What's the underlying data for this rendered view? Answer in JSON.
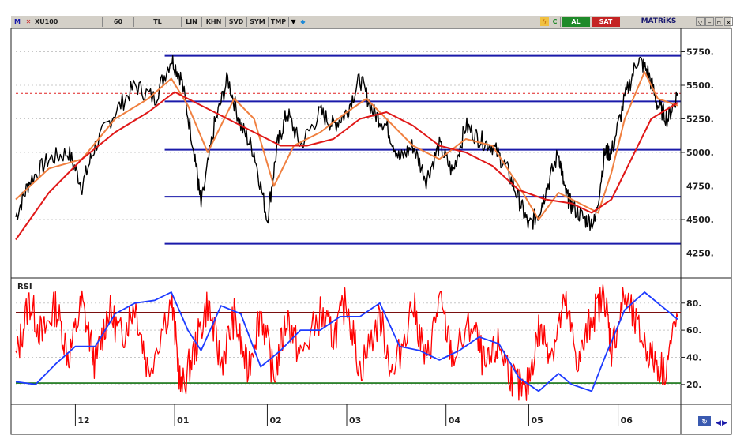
{
  "toolbar": {
    "symbol_prefix": "M",
    "symbol": "XU100",
    "period": "60",
    "currency": "TL",
    "scale_lin": "LIN",
    "scale_khn": "KHN",
    "btn_svd": "SVD",
    "btn_sym": "SYM",
    "btn_tmp": "TMP",
    "btn_c": "C",
    "btn_al": "AL",
    "btn_sat": "SAT",
    "brand": "MATRiKS",
    "icons": [
      "bird-icon",
      "lightning-icon",
      "dropdown-arrow-icon",
      "minimize-icon",
      "maximize-icon",
      "close-icon"
    ]
  },
  "colors": {
    "price": "#000000",
    "ma_fast": "#f08040",
    "ma_slow": "#e01818",
    "levels": "#1a1aaa",
    "rsi": "#ff0000",
    "rsi_ma": "#1e3cff",
    "rsi_upper": "#7a1010",
    "rsi_lower": "#107010",
    "last_price_line": "#e02020"
  },
  "chart_data": [
    {
      "type": "line",
      "panel": "price",
      "y_ticks": [
        "5750.",
        "5500.",
        "5250.",
        "5000.",
        "4750.",
        "4500.",
        "4250."
      ],
      "ylim": [
        4100,
        5900
      ],
      "x_month_labels": [
        "12",
        "01",
        "02",
        "03",
        "04",
        "05",
        "06"
      ],
      "x_month_positions": [
        0.09,
        0.24,
        0.38,
        0.5,
        0.65,
        0.775,
        0.91
      ],
      "horizontal_levels": [
        5720,
        5380,
        5020,
        4670,
        4320
      ],
      "last_price_level": 5440,
      "series": [
        {
          "role": "price",
          "points": [
            [
              0,
              4520
            ],
            [
              0.02,
              4780
            ],
            [
              0.05,
              4950
            ],
            [
              0.08,
              5000
            ],
            [
              0.1,
              4750
            ],
            [
              0.12,
              5050
            ],
            [
              0.15,
              5300
            ],
            [
              0.18,
              5500
            ],
            [
              0.21,
              5400
            ],
            [
              0.235,
              5700
            ],
            [
              0.25,
              5550
            ],
            [
              0.27,
              5000
            ],
            [
              0.28,
              4600
            ],
            [
              0.3,
              5200
            ],
            [
              0.32,
              5550
            ],
            [
              0.34,
              5200
            ],
            [
              0.36,
              5000
            ],
            [
              0.38,
              4500
            ],
            [
              0.395,
              5050
            ],
            [
              0.41,
              5300
            ],
            [
              0.43,
              5050
            ],
            [
              0.46,
              5300
            ],
            [
              0.48,
              5200
            ],
            [
              0.5,
              5300
            ],
            [
              0.52,
              5550
            ],
            [
              0.54,
              5300
            ],
            [
              0.56,
              5200
            ],
            [
              0.58,
              4950
            ],
            [
              0.6,
              5050
            ],
            [
              0.62,
              4800
            ],
            [
              0.64,
              5050
            ],
            [
              0.66,
              4850
            ],
            [
              0.68,
              5200
            ],
            [
              0.7,
              5100
            ],
            [
              0.72,
              5050
            ],
            [
              0.74,
              4900
            ],
            [
              0.76,
              4650
            ],
            [
              0.775,
              4450
            ],
            [
              0.79,
              4550
            ],
            [
              0.8,
              4700
            ],
            [
              0.82,
              5000
            ],
            [
              0.83,
              4700
            ],
            [
              0.84,
              4600
            ],
            [
              0.86,
              4500
            ],
            [
              0.875,
              4480
            ],
            [
              0.89,
              5000
            ],
            [
              0.9,
              5000
            ],
            [
              0.92,
              5400
            ],
            [
              0.94,
              5700
            ],
            [
              0.955,
              5600
            ],
            [
              0.97,
              5350
            ],
            [
              0.985,
              5250
            ],
            [
              1,
              5440
            ]
          ]
        },
        {
          "role": "ma_fast",
          "points": [
            [
              0,
              4650
            ],
            [
              0.05,
              4880
            ],
            [
              0.1,
              4950
            ],
            [
              0.15,
              5250
            ],
            [
              0.2,
              5400
            ],
            [
              0.235,
              5550
            ],
            [
              0.26,
              5350
            ],
            [
              0.29,
              5000
            ],
            [
              0.33,
              5400
            ],
            [
              0.36,
              5250
            ],
            [
              0.39,
              4750
            ],
            [
              0.42,
              5050
            ],
            [
              0.46,
              5150
            ],
            [
              0.5,
              5300
            ],
            [
              0.53,
              5400
            ],
            [
              0.56,
              5250
            ],
            [
              0.6,
              5050
            ],
            [
              0.64,
              4950
            ],
            [
              0.68,
              5100
            ],
            [
              0.72,
              5050
            ],
            [
              0.76,
              4750
            ],
            [
              0.79,
              4500
            ],
            [
              0.82,
              4700
            ],
            [
              0.86,
              4600
            ],
            [
              0.88,
              4550
            ],
            [
              0.9,
              4850
            ],
            [
              0.92,
              5250
            ],
            [
              0.95,
              5600
            ],
            [
              0.97,
              5400
            ],
            [
              1,
              5350
            ]
          ]
        },
        {
          "role": "ma_slow",
          "points": [
            [
              0,
              4350
            ],
            [
              0.05,
              4700
            ],
            [
              0.1,
              4950
            ],
            [
              0.15,
              5150
            ],
            [
              0.2,
              5300
            ],
            [
              0.24,
              5450
            ],
            [
              0.28,
              5350
            ],
            [
              0.32,
              5250
            ],
            [
              0.36,
              5150
            ],
            [
              0.4,
              5050
            ],
            [
              0.44,
              5050
            ],
            [
              0.48,
              5100
            ],
            [
              0.52,
              5250
            ],
            [
              0.56,
              5300
            ],
            [
              0.6,
              5200
            ],
            [
              0.64,
              5050
            ],
            [
              0.68,
              5000
            ],
            [
              0.72,
              4900
            ],
            [
              0.76,
              4720
            ],
            [
              0.8,
              4650
            ],
            [
              0.84,
              4620
            ],
            [
              0.87,
              4550
            ],
            [
              0.9,
              4650
            ],
            [
              0.93,
              4950
            ],
            [
              0.96,
              5250
            ],
            [
              1,
              5370
            ]
          ]
        }
      ]
    },
    {
      "type": "line",
      "panel": "rsi",
      "title": "RSI",
      "y_ticks": [
        "80.",
        "60.",
        "40.",
        "20."
      ],
      "ylim": [
        10,
        95
      ],
      "upper_level": 73,
      "lower_level": 21,
      "series": [
        {
          "role": "rsi",
          "points": [
            [
              0,
              38
            ],
            [
              0.02,
              82
            ],
            [
              0.04,
              55
            ],
            [
              0.06,
              78
            ],
            [
              0.08,
              40
            ],
            [
              0.1,
              80
            ],
            [
              0.12,
              35
            ],
            [
              0.14,
              75
            ],
            [
              0.16,
              55
            ],
            [
              0.18,
              80
            ],
            [
              0.2,
              30
            ],
            [
              0.235,
              82
            ],
            [
              0.25,
              15
            ],
            [
              0.27,
              45
            ],
            [
              0.29,
              80
            ],
            [
              0.31,
              35
            ],
            [
              0.33,
              70
            ],
            [
              0.35,
              30
            ],
            [
              0.37,
              75
            ],
            [
              0.39,
              25
            ],
            [
              0.41,
              70
            ],
            [
              0.43,
              40
            ],
            [
              0.46,
              72
            ],
            [
              0.48,
              55
            ],
            [
              0.5,
              82
            ],
            [
              0.52,
              30
            ],
            [
              0.55,
              70
            ],
            [
              0.57,
              25
            ],
            [
              0.6,
              80
            ],
            [
              0.62,
              35
            ],
            [
              0.64,
              82
            ],
            [
              0.66,
              40
            ],
            [
              0.69,
              65
            ],
            [
              0.71,
              30
            ],
            [
              0.73,
              50
            ],
            [
              0.75,
              25
            ],
            [
              0.77,
              12
            ],
            [
              0.79,
              60
            ],
            [
              0.81,
              45
            ],
            [
              0.83,
              80
            ],
            [
              0.85,
              35
            ],
            [
              0.87,
              70
            ],
            [
              0.89,
              85
            ],
            [
              0.9,
              45
            ],
            [
              0.92,
              85
            ],
            [
              0.94,
              60
            ],
            [
              0.96,
              40
            ],
            [
              0.98,
              30
            ],
            [
              1,
              70
            ]
          ]
        },
        {
          "role": "rsi_ma",
          "points": [
            [
              0,
              22
            ],
            [
              0.03,
              20
            ],
            [
              0.06,
              35
            ],
            [
              0.09,
              48
            ],
            [
              0.12,
              48
            ],
            [
              0.15,
              72
            ],
            [
              0.18,
              80
            ],
            [
              0.21,
              82
            ],
            [
              0.235,
              88
            ],
            [
              0.26,
              60
            ],
            [
              0.28,
              45
            ],
            [
              0.31,
              78
            ],
            [
              0.34,
              72
            ],
            [
              0.37,
              33
            ],
            [
              0.4,
              45
            ],
            [
              0.43,
              60
            ],
            [
              0.46,
              60
            ],
            [
              0.49,
              70
            ],
            [
              0.52,
              70
            ],
            [
              0.55,
              80
            ],
            [
              0.58,
              48
            ],
            [
              0.61,
              45
            ],
            [
              0.64,
              38
            ],
            [
              0.67,
              45
            ],
            [
              0.7,
              55
            ],
            [
              0.73,
              50
            ],
            [
              0.76,
              25
            ],
            [
              0.79,
              15
            ],
            [
              0.82,
              28
            ],
            [
              0.84,
              20
            ],
            [
              0.87,
              15
            ],
            [
              0.89,
              40
            ],
            [
              0.92,
              75
            ],
            [
              0.95,
              88
            ],
            [
              0.98,
              76
            ],
            [
              1,
              68
            ]
          ]
        }
      ]
    }
  ]
}
